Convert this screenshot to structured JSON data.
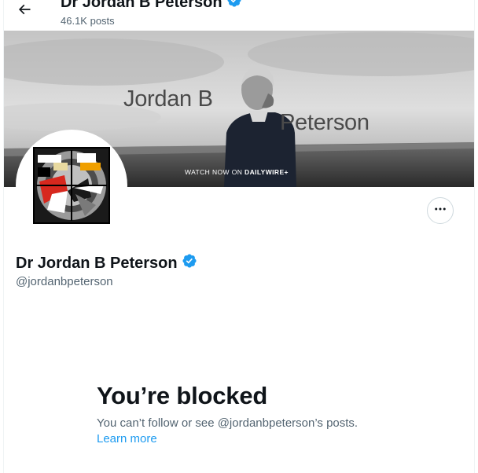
{
  "header": {
    "back_label": "Back",
    "name": "Dr Jordan B Peterson",
    "posts": "46.1K posts"
  },
  "banner": {
    "line1": "Jordan B",
    "line2": "Peterson",
    "watch_prefix": "WATCH NOW ON ",
    "watch_brand": "DAILYWIRE+"
  },
  "profile": {
    "name": "Dr Jordan B Peterson",
    "handle": "@jordanbpeterson",
    "verified": true
  },
  "blocked": {
    "title": "You’re blocked",
    "description": "You can’t follow or see @jordanbpeterson’s posts.",
    "learn_more": "Learn more"
  },
  "colors": {
    "accent": "#1d9bf0",
    "text_primary": "#0f1419",
    "text_secondary": "#536471",
    "border": "#cfd9de"
  },
  "icons": {
    "back": "arrow-left-icon",
    "verified": "verified-badge-icon",
    "more": "more-horizontal-icon"
  }
}
